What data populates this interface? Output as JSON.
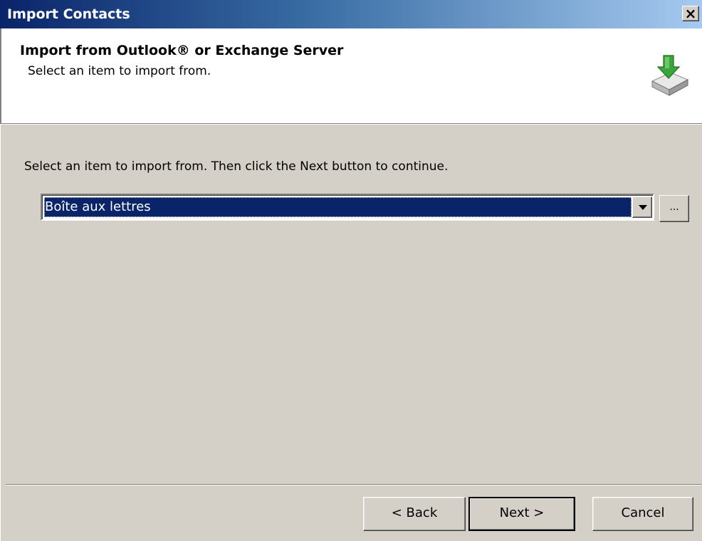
{
  "window": {
    "title": "Import Contacts",
    "close_icon": "close-icon",
    "close_glyph": "✕"
  },
  "header": {
    "title": "Import from Outlook® or Exchange Server",
    "subtitle": "Select an item to import from.",
    "icon": "import-download-icon"
  },
  "main": {
    "instruction": "Select an item to import from.  Then click the Next button to continue.",
    "source_select": {
      "value": "Boîte aux lettres",
      "arrow_icon": "chevron-down-icon"
    },
    "browse_label": "..."
  },
  "buttons": {
    "back": "< Back",
    "next": "Next >",
    "cancel": "Cancel"
  },
  "colors": {
    "title_bar_start": "#0a246a",
    "title_bar_end": "#a6caf0",
    "selection": "#0a246a",
    "dialog_face": "#d4d0c8",
    "arrow_green": "#3aa63a"
  }
}
